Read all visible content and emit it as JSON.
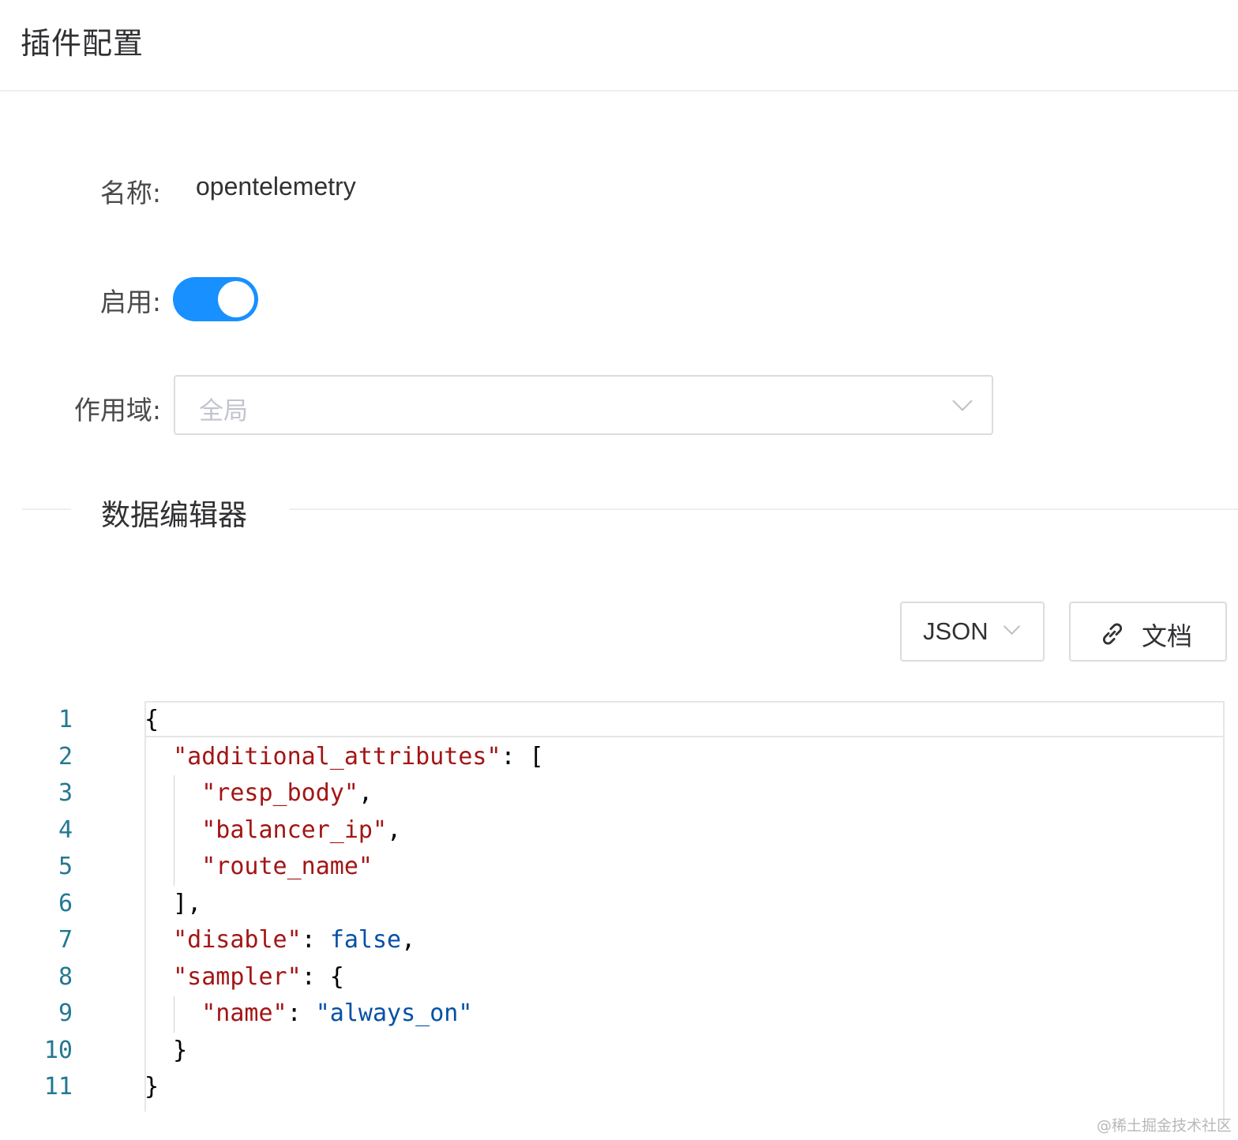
{
  "header": {
    "title": "插件配置"
  },
  "form": {
    "name_label": "名称:",
    "name_value": "opentelemetry",
    "enable_label": "启用:",
    "enabled": true,
    "scope_label": "作用域:",
    "scope_placeholder": "全局"
  },
  "divider": {
    "text": "数据编辑器"
  },
  "toolbar": {
    "format_label": "JSON",
    "docs_label": "文档",
    "docs_icon": "link-icon"
  },
  "editor": {
    "lines": [
      {
        "n": "1",
        "indent": "",
        "parts": [
          [
            "punc",
            "{"
          ]
        ]
      },
      {
        "n": "2",
        "indent": "  ",
        "parts": [
          [
            "key",
            "\"additional_attributes\""
          ],
          [
            "punc",
            ": ["
          ]
        ]
      },
      {
        "n": "3",
        "indent": "    ",
        "parts": [
          [
            "key",
            "\"resp_body\""
          ],
          [
            "punc",
            ","
          ]
        ]
      },
      {
        "n": "4",
        "indent": "    ",
        "parts": [
          [
            "key",
            "\"balancer_ip\""
          ],
          [
            "punc",
            ","
          ]
        ]
      },
      {
        "n": "5",
        "indent": "    ",
        "parts": [
          [
            "key",
            "\"route_name\""
          ]
        ]
      },
      {
        "n": "6",
        "indent": "  ",
        "parts": [
          [
            "punc",
            "],"
          ]
        ]
      },
      {
        "n": "7",
        "indent": "  ",
        "parts": [
          [
            "key",
            "\"disable\""
          ],
          [
            "punc",
            ": "
          ],
          [
            "kw",
            "false"
          ],
          [
            "punc",
            ","
          ]
        ]
      },
      {
        "n": "8",
        "indent": "  ",
        "parts": [
          [
            "key",
            "\"sampler\""
          ],
          [
            "punc",
            ": {"
          ]
        ]
      },
      {
        "n": "9",
        "indent": "    ",
        "parts": [
          [
            "key",
            "\"name\""
          ],
          [
            "punc",
            ": "
          ],
          [
            "str",
            "\"always_on\""
          ]
        ]
      },
      {
        "n": "10",
        "indent": "  ",
        "parts": [
          [
            "punc",
            "}"
          ]
        ]
      },
      {
        "n": "11",
        "indent": "",
        "parts": [
          [
            "punc",
            "}"
          ]
        ]
      }
    ]
  },
  "watermark": "@稀土掘金技术社区",
  "colors": {
    "accent": "#1890ff",
    "json_key": "#a31515",
    "json_string": "#0451a5",
    "line_number": "#237893"
  }
}
